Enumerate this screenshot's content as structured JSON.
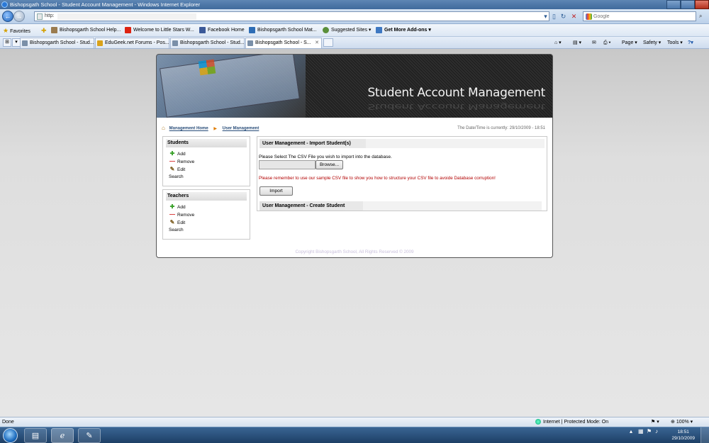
{
  "window": {
    "title": "Bishopsgath School - Student Account Management - Windows Internet Explorer"
  },
  "address_bar": {
    "url": "http:",
    "search_placeholder": "Google"
  },
  "favorites_bar": {
    "favorites_label": "Favorites",
    "items": [
      "Bishopsgarth School Help...",
      "Welcome to Little Stars W...",
      "Facebook",
      "Home",
      "Bishopsgarth School Mat...",
      "Suggested Sites ▾",
      "Get More Add-ons ▾"
    ]
  },
  "tabs": [
    "Bishopsgarth School - Stud...",
    "EduGeek.net Forums - Pos...",
    "Bishopsgarth School - Stud...",
    "Bishopsgath School - S..."
  ],
  "command_bar": {
    "page": "Page ▾",
    "safety": "Safety ▾",
    "tools": "Tools ▾",
    "help": "?▾"
  },
  "page": {
    "banner_title": "Student Account Management",
    "breadcrumb": {
      "home": "Management Home",
      "current": "User Management"
    },
    "datetime": "The Date/Time is currently: 29/10/2009 - 18:51",
    "sidebar": {
      "students": {
        "title": "Students",
        "items": [
          "Add",
          "Remove",
          "Edit",
          "Search"
        ]
      },
      "teachers": {
        "title": "Teachers",
        "items": [
          "Add",
          "Remove",
          "Edit",
          "Search"
        ]
      }
    },
    "import_section": {
      "title": "User Management - Import Student(s)",
      "prompt": "Please Select The CSV File you wish to import into the database.",
      "browse_label": "Browse...",
      "warning": "Please remember to use our sample CSV file to show you how to structure your CSV file to avoide Database corruption!",
      "import_label": "Import"
    },
    "create_section": {
      "title": "User Management - Create Student"
    },
    "copyright": "Copyright Bishopsgarth School, All Rights Reserved © 2009"
  },
  "status_bar": {
    "status": "Done",
    "zone": "Internet | Protected Mode: On",
    "zoom": "100%"
  },
  "taskbar": {
    "time": "18:51",
    "date": "29/10/2009"
  }
}
